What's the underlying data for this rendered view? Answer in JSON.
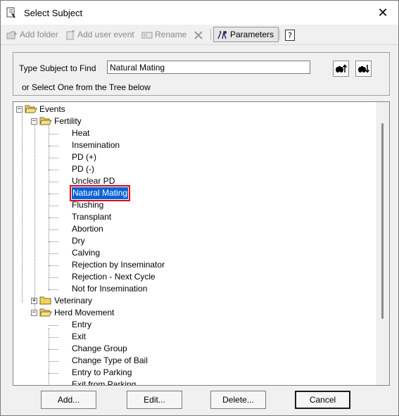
{
  "window": {
    "title": "Select Subject",
    "close_glyph": "✕"
  },
  "toolbar": {
    "add_folder": "Add folder",
    "add_user_event": "Add user event",
    "rename": "Rename",
    "parameters": "Parameters"
  },
  "find": {
    "label": "Type Subject to Find",
    "value": "Natural Mating",
    "hint": "or Select One from the Tree below"
  },
  "tree": {
    "events": "Events",
    "fertility": "Fertility",
    "fertility_items": [
      "Heat",
      "Insemination",
      "PD (+)",
      "PD (-)",
      "Unclear PD",
      "Natural Mating",
      "Flushing",
      "Transplant",
      "Abortion",
      "Dry",
      "Calving",
      "Rejection by Inseminator",
      "Rejection - Next Cycle",
      "Not for Insemination"
    ],
    "veterinary": "Veterinary",
    "herd_movement": "Herd Movement",
    "herd_items": [
      "Entry",
      "Exit",
      "Change Group",
      "Change Type of Bail",
      "Entry to Parking",
      "Exit from Parking"
    ],
    "selected": "Natural Mating"
  },
  "buttons": {
    "add": "Add...",
    "edit": "Edit...",
    "delete": "Delete...",
    "cancel": "Cancel"
  },
  "colors": {
    "selection": "#0a64d6",
    "highlight_border": "#e0001b",
    "folder": "#f2d25c"
  }
}
